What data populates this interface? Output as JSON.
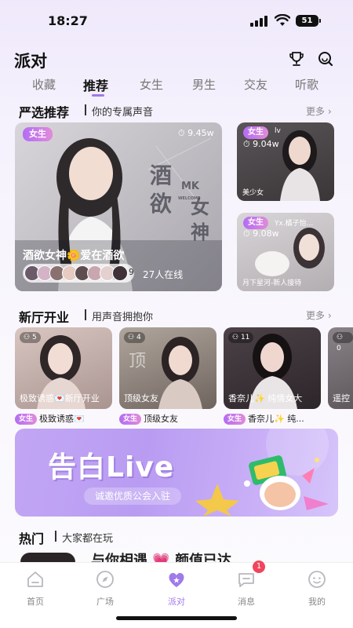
{
  "status": {
    "time": "18:27",
    "battery": "51"
  },
  "header": {
    "title": "派对",
    "trophy_icon": "trophy-icon",
    "search_icon": "search-icon"
  },
  "tabs": [
    {
      "label": "收藏"
    },
    {
      "label": "推荐",
      "active": true
    },
    {
      "label": "女生"
    },
    {
      "label": "男生"
    },
    {
      "label": "交友"
    },
    {
      "label": "听歌"
    }
  ],
  "featured": {
    "title": "严选推荐",
    "subtitle": "你的专属声音",
    "more": "更多",
    "main_card": {
      "tag": "女生",
      "heat": "9.45w",
      "poster_text": [
        "酒",
        "欲",
        "女",
        "神"
      ],
      "poster_mark": "MK",
      "poster_welcome": "WELCOME",
      "name": "酒欲女神🌼爱在酒欲",
      "avatar_extra": "9",
      "online": "27人在线"
    },
    "side_cards": [
      {
        "tag": "女生",
        "heat": "9.04w",
        "caption": "美少女",
        "top_text": "lv"
      },
      {
        "tag": "女生",
        "heat": "9.08w",
        "caption": "月下星河-新人接待",
        "top_text": "Yx.橘子怡..."
      }
    ]
  },
  "new_rooms": {
    "title": "新厅开业",
    "subtitle": "用声音拥抱你",
    "more": "更多",
    "rooms": [
      {
        "count": "5",
        "caption": "极致诱惑💌新厅开业",
        "label": "极致诱惑💌",
        "tag": "女生"
      },
      {
        "count": "4",
        "caption": "顶级女友",
        "label": "顶级女友",
        "tag": "女生"
      },
      {
        "count": "11",
        "caption": "香奈儿✨ 纯情女大",
        "label": "香奈儿✨ 纯...",
        "tag": "女生"
      },
      {
        "count": "0",
        "caption": "遥控",
        "label": "",
        "tag": ""
      }
    ]
  },
  "banner": {
    "title": "告白Live",
    "subtitle": "诚邀优质公会入驻"
  },
  "hot": {
    "title": "热门",
    "subtitle": "大家都在玩",
    "peek_text": "与你相遇 💗 颜值已达"
  },
  "tabbar": {
    "items": [
      {
        "label": "首页",
        "icon": "home-icon"
      },
      {
        "label": "广场",
        "icon": "compass-icon"
      },
      {
        "label": "派对",
        "icon": "party-heart-icon",
        "active": true
      },
      {
        "label": "消息",
        "icon": "message-icon"
      },
      {
        "label": "我的",
        "icon": "profile-icon"
      }
    ],
    "message_badge": "1"
  },
  "colors": {
    "accent": "#a07ae9",
    "tag_gradient_start": "#b46cf5",
    "badge": "#f0455d"
  }
}
